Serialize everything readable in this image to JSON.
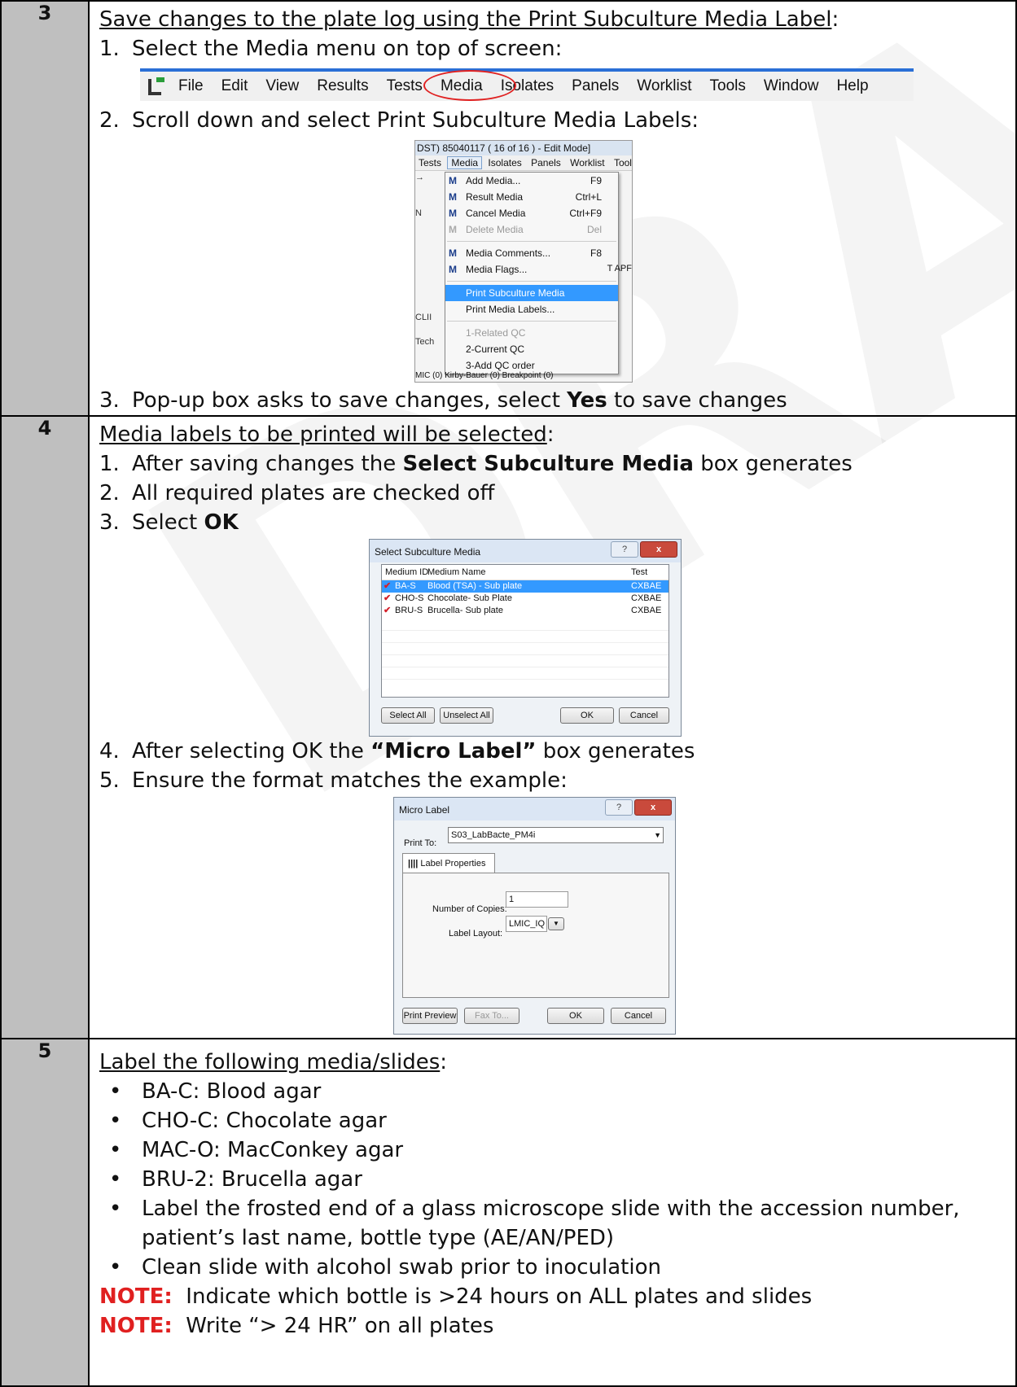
{
  "watermark": "DRAFT",
  "rows": {
    "r3": {
      "num": "3",
      "heading": "Save changes to the plate log using the Print Subculture Media Label",
      "heading_suffix": ":",
      "step1": "Select the Media menu on top of screen:",
      "menubar": [
        "File",
        "Edit",
        "View",
        "Results",
        "Tests",
        "Media",
        "Isolates",
        "Panels",
        "Worklist",
        "Tools",
        "Window",
        "Help"
      ],
      "step2": "Scroll down and select Print Subculture Media Labels:",
      "menushot": {
        "title": "DST) 85040117 ( 16 of 16 ) - Edit Mode]",
        "menu": [
          "Tests",
          "Media",
          "Isolates",
          "Panels",
          "Worklist",
          "Tools"
        ],
        "items": [
          {
            "label": "Add Media...",
            "key": "F9",
            "icon": "M"
          },
          {
            "label": "Result Media",
            "key": "Ctrl+L",
            "icon": "M"
          },
          {
            "label": "Cancel Media",
            "key": "Ctrl+F9",
            "icon": "M"
          },
          {
            "label": "Delete Media",
            "key": "Del",
            "icon": "M"
          },
          {
            "label": "Media Comments...",
            "key": "F8",
            "icon": "M"
          },
          {
            "label": "Media Flags...",
            "key": "",
            "icon": "M"
          },
          {
            "label": "Print Subculture Media Labels...",
            "key": ""
          },
          {
            "label": "Print Media Labels...",
            "key": ""
          },
          {
            "label": "1-Related QC",
            "key": ""
          },
          {
            "label": "2-Current QC",
            "key": ""
          },
          {
            "label": "3-Add QC order",
            "key": ""
          }
        ],
        "side": [
          "N",
          "CLII",
          "Tech"
        ],
        "side_right": "T APF",
        "footer": "MIC (0)   Kirby-Bauer (0)   Breakpoint (0)"
      },
      "step3_a": "Pop-up box asks to save changes, select ",
      "step3_b": "Yes",
      "step3_c": " to save changes"
    },
    "r4": {
      "num": "4",
      "heading": "Media labels to be printed will be selected",
      "heading_suffix": ":",
      "step1_a": "After saving changes the ",
      "step1_b": "Select Subculture Media",
      "step1_c": " box generates",
      "step2": "All required plates are checked off",
      "step3_a": "Select ",
      "step3_b": "OK",
      "sub_dialog": {
        "title": "Select Subculture Media",
        "columns": [
          "Medium ID",
          "Medium Name",
          "Test"
        ],
        "rows": [
          {
            "id": "BA-S",
            "name": "Blood (TSA) - Sub plate",
            "test": "CXBAE"
          },
          {
            "id": "CHO-S",
            "name": "Chocolate- Sub Plate",
            "test": "CXBAE"
          },
          {
            "id": "BRU-S",
            "name": "Brucella- Sub plate",
            "test": "CXBAE"
          }
        ],
        "btn_select_all": "Select All",
        "btn_unselect_all": "Unselect All",
        "btn_ok": "OK",
        "btn_cancel": "Cancel"
      },
      "step4_a": "After selecting OK the ",
      "step4_b": "“Micro Label”",
      "step4_c": " box generates",
      "step5": "Ensure the format matches the example:",
      "ml_dialog": {
        "title": "Micro Label",
        "print_to_label": "Print To:",
        "print_to_value": "S03_LabBacte_PM4i",
        "tab": "Label Properties",
        "copies_label": "Number of Copies:",
        "copies_value": "1",
        "layout_label": "Label Layout:",
        "layout_value": "LMIC_IQ",
        "btn_preview": "Print Preview",
        "btn_fax": "Fax To...",
        "btn_ok": "OK",
        "btn_cancel": "Cancel"
      }
    },
    "r5": {
      "num": "5",
      "heading": "Label the following media/slides",
      "heading_suffix": ":",
      "bullets": [
        "BA-C:  Blood agar",
        "CHO-C:  Chocolate agar",
        "MAC-O:  MacConkey agar",
        "BRU-2:  Brucella agar",
        "Label the frosted end of a glass microscope slide with the accession number, patient’s last name, bottle type (AE/AN/PED)",
        "Clean slide with alcohol swab prior to inoculation"
      ],
      "note1_label": "NOTE:",
      "note1_text": "  Indicate which bottle is >24 hours on ALL plates and slides",
      "note2_label": "NOTE:",
      "note2_text": "  Write “> 24 HR” on all plates"
    }
  }
}
